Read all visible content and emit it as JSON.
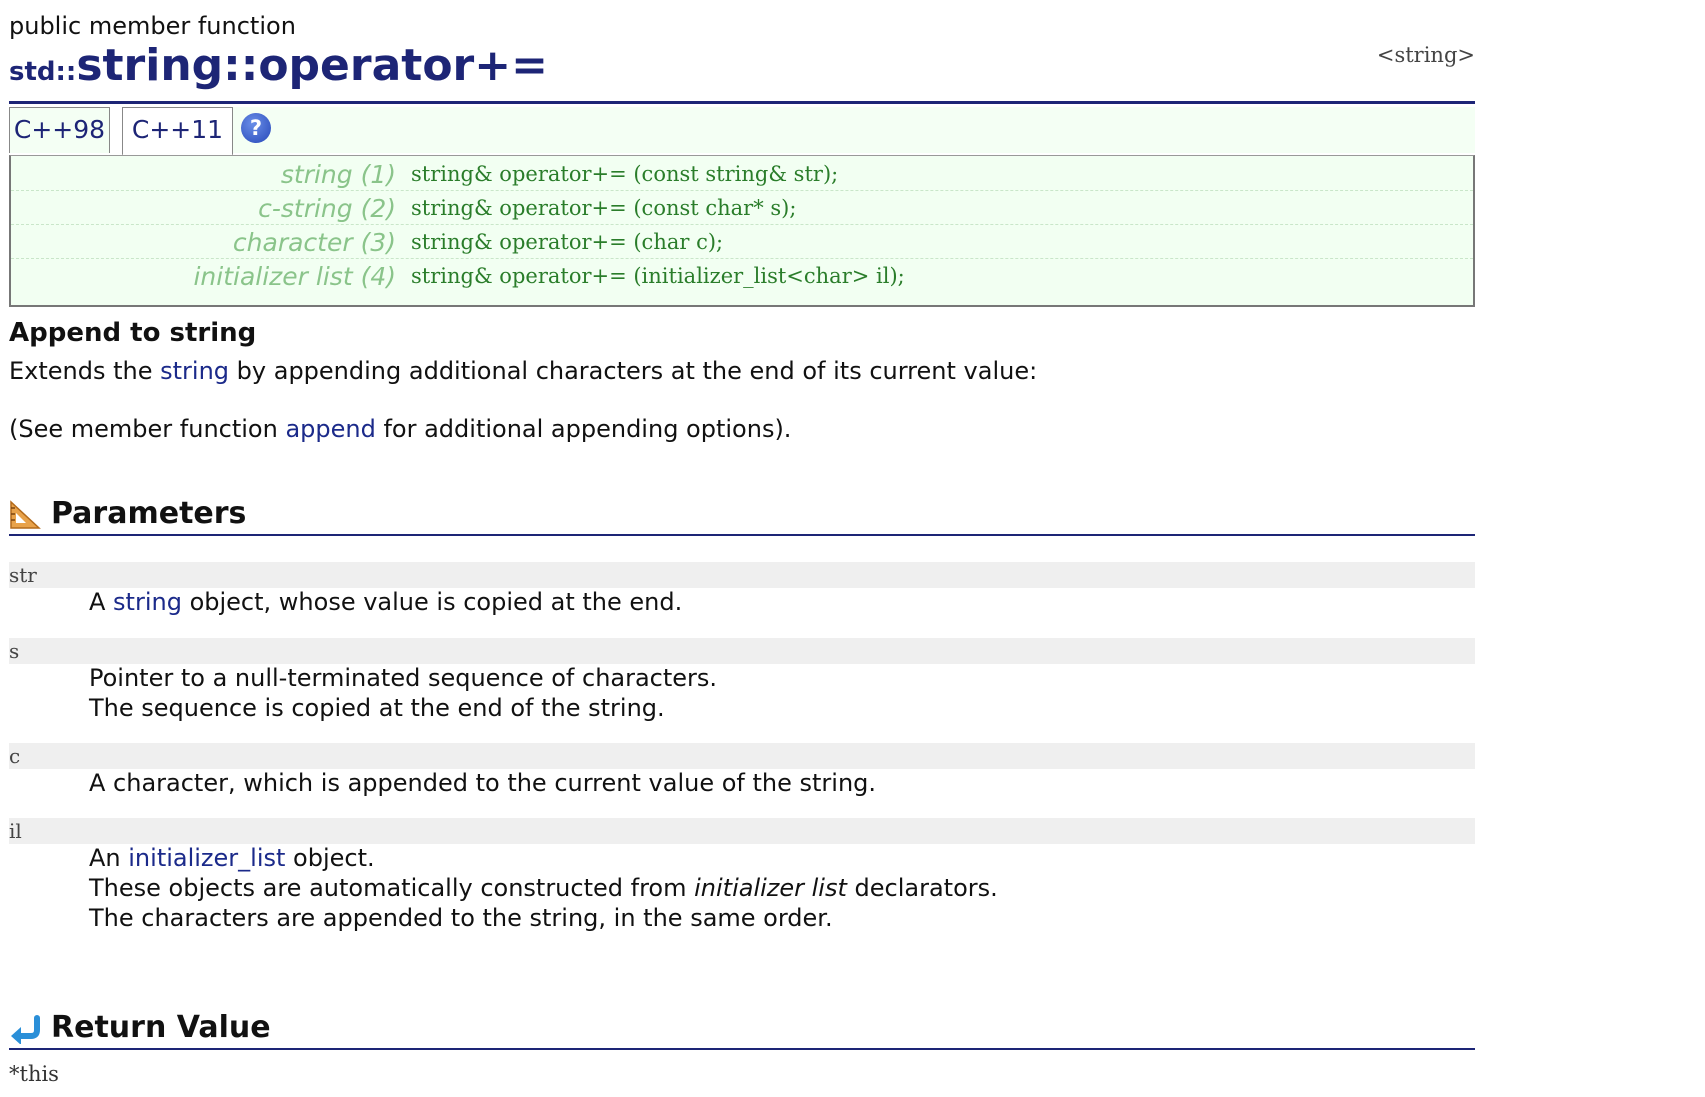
{
  "kind_label": "public member function",
  "header_ref": "<string>",
  "title": {
    "namespace": "std::",
    "name": "string::operator+="
  },
  "tabs": [
    {
      "label": "C++98"
    },
    {
      "label": "C++11"
    }
  ],
  "help_icon_glyph": "?",
  "prototypes": [
    {
      "label": "string (1)",
      "code": "string& operator+= (const string& str);"
    },
    {
      "label": "c-string (2)",
      "code": "string& operator+= (const char* s);"
    },
    {
      "label": "character (3)",
      "code": "string& operator+= (char c);"
    },
    {
      "label": "initializer list (4)",
      "code": "string& operator+= (initializer_list<char> il);"
    }
  ],
  "summary_heading": "Append to string",
  "description": {
    "p1_before": "Extends the ",
    "p1_link": "string",
    "p1_after": " by appending additional characters at the end of its current value:",
    "p2_before": "(See member function ",
    "p2_link": "append",
    "p2_after": " for additional appending options)."
  },
  "parameters": {
    "heading": "Parameters",
    "icon": "set-square-icon",
    "items": [
      {
        "name": "str",
        "lines": [
          "A ",
          "string",
          " object, whose value is copied at the end."
        ]
      },
      {
        "name": "s",
        "lines": [
          "Pointer to a null-terminated sequence of characters.",
          "The sequence is copied at the end of the string."
        ]
      },
      {
        "name": "c",
        "lines": [
          "A character, which is appended to the current value of the string."
        ]
      },
      {
        "name": "il",
        "lines": [
          "An ",
          "initializer_list",
          " object.",
          "These objects are automatically constructed from ",
          "initializer list",
          " declarators.",
          "The characters are appended to the string, in the same order."
        ]
      }
    ]
  },
  "return_value": {
    "heading": "Return Value",
    "icon": "return-arrow-icon",
    "text": "*this"
  },
  "colors": {
    "title": "#1d2576",
    "link": "#1b2a8a",
    "proto_bg": "#f2fff2",
    "proto_label": "#8ac48a",
    "proto_code": "#2a7d2a"
  }
}
